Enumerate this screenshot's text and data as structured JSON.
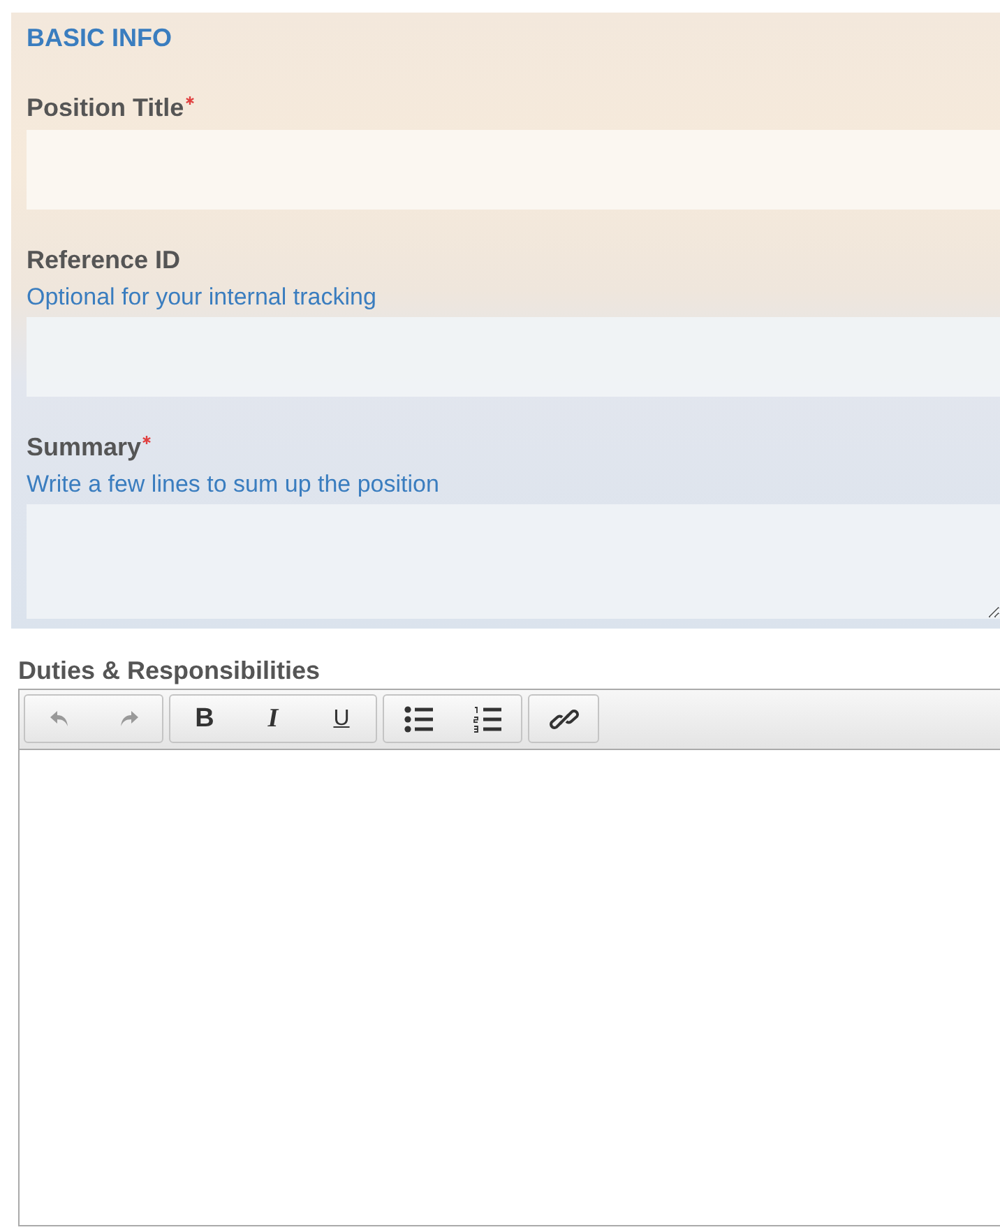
{
  "section": {
    "title": "BASIC INFO",
    "fields": [
      {
        "label": "Position Title",
        "required": true,
        "kind": "input"
      },
      {
        "label": "Reference ID",
        "required": false,
        "hint": "Optional for your internal tracking",
        "kind": "input"
      },
      {
        "label": "Summary",
        "required": true,
        "hint": "Write a few lines to sum up the position",
        "kind": "textarea"
      }
    ]
  },
  "editor": {
    "label": "Duties & Responsibilities",
    "toolbar": [
      [
        {
          "kind": "undo",
          "disabled": true
        },
        {
          "kind": "redo",
          "disabled": true
        }
      ],
      [
        {
          "kind": "bold",
          "text": "B",
          "disabled": false
        },
        {
          "kind": "italic",
          "text": "I",
          "disabled": false
        },
        {
          "kind": "underline",
          "text": "U",
          "disabled": false
        }
      ],
      [
        {
          "kind": "bullets",
          "disabled": false
        },
        {
          "kind": "numbers",
          "disabled": false
        }
      ],
      [
        {
          "kind": "link",
          "disabled": false
        }
      ]
    ]
  }
}
